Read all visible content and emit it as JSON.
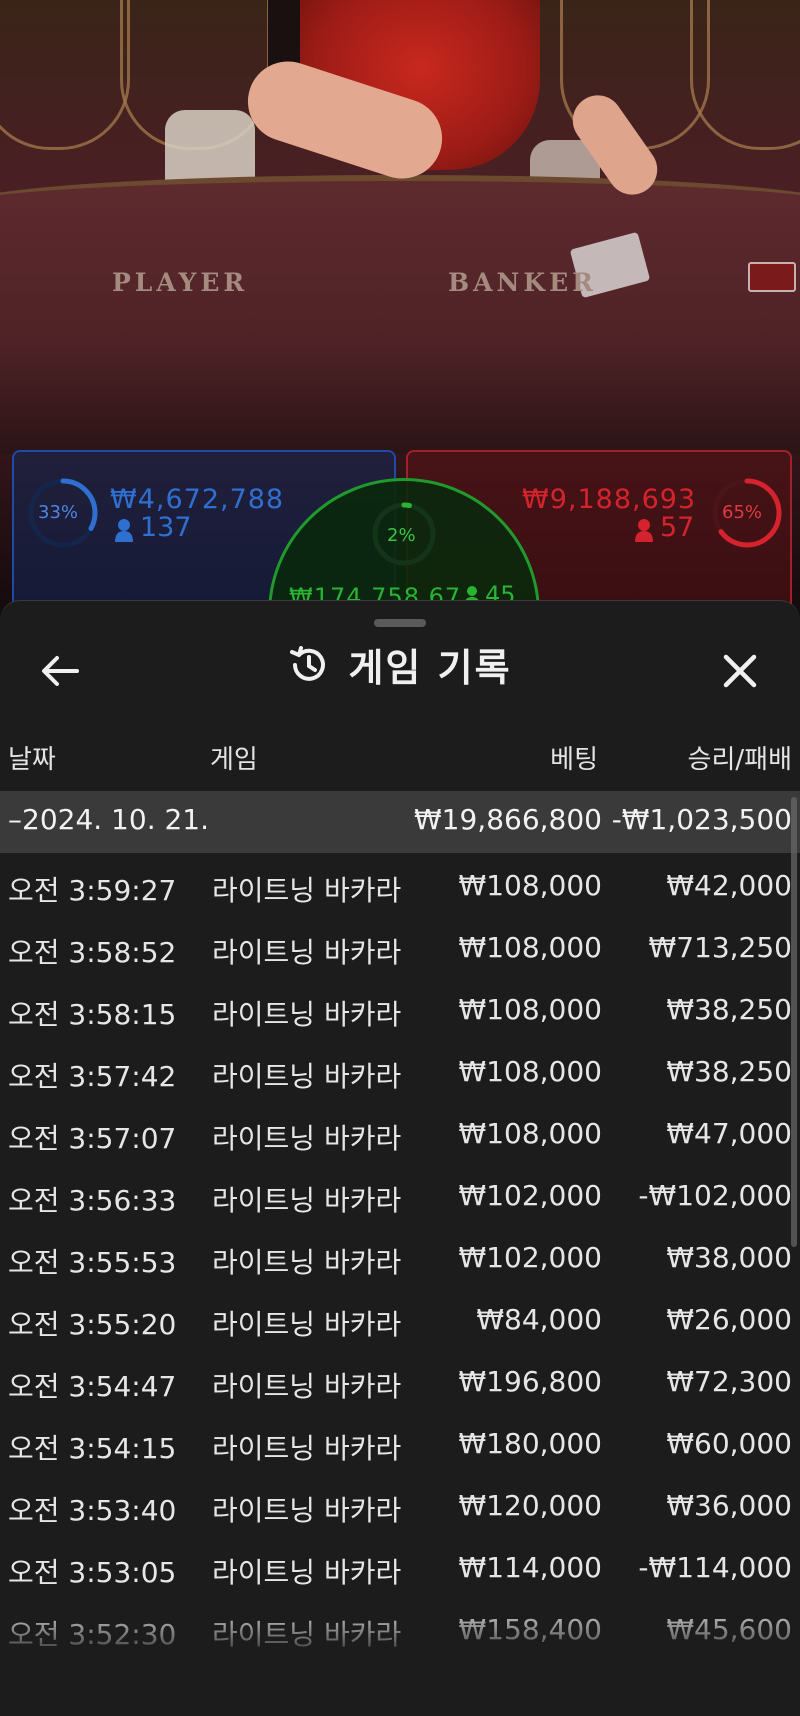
{
  "video": {
    "table_labels": {
      "player": "PLAYER",
      "banker": "BANKER"
    }
  },
  "bets": {
    "player": {
      "percent": "33%",
      "amount": "₩4,672,788",
      "count": "137",
      "color": "#2f6fd0"
    },
    "banker": {
      "percent": "65%",
      "amount": "₩9,188,693",
      "count": "57",
      "color": "#d4232c"
    },
    "tie": {
      "percent": "2%",
      "amount": "₩174,758.67",
      "count": "45",
      "color": "#28b332"
    }
  },
  "sheet": {
    "back_icon": "arrow-left-icon",
    "history_icon": "history-icon",
    "title": "게임 기록",
    "close_icon": "close-icon",
    "columns": {
      "date": "날짜",
      "game": "게임",
      "bet": "베팅",
      "result": "승리/패배"
    },
    "summary": {
      "date": "–2024. 10. 21.",
      "bet": "₩19,866,800",
      "result": "-₩1,023,500"
    },
    "rows": [
      {
        "time": "오전 3:59:27",
        "game": "라이트닝 바카라",
        "bet": "₩108,000",
        "result": "₩42,000"
      },
      {
        "time": "오전 3:58:52",
        "game": "라이트닝 바카라",
        "bet": "₩108,000",
        "result": "₩713,250"
      },
      {
        "time": "오전 3:58:15",
        "game": "라이트닝 바카라",
        "bet": "₩108,000",
        "result": "₩38,250"
      },
      {
        "time": "오전 3:57:42",
        "game": "라이트닝 바카라",
        "bet": "₩108,000",
        "result": "₩38,250"
      },
      {
        "time": "오전 3:57:07",
        "game": "라이트닝 바카라",
        "bet": "₩108,000",
        "result": "₩47,000"
      },
      {
        "time": "오전 3:56:33",
        "game": "라이트닝 바카라",
        "bet": "₩102,000",
        "result": "-₩102,000"
      },
      {
        "time": "오전 3:55:53",
        "game": "라이트닝 바카라",
        "bet": "₩102,000",
        "result": "₩38,000"
      },
      {
        "time": "오전 3:55:20",
        "game": "라이트닝 바카라",
        "bet": "₩84,000",
        "result": "₩26,000"
      },
      {
        "time": "오전 3:54:47",
        "game": "라이트닝 바카라",
        "bet": "₩196,800",
        "result": "₩72,300"
      },
      {
        "time": "오전 3:54:15",
        "game": "라이트닝 바카라",
        "bet": "₩180,000",
        "result": "₩60,000"
      },
      {
        "time": "오전 3:53:40",
        "game": "라이트닝 바카라",
        "bet": "₩120,000",
        "result": "₩36,000"
      },
      {
        "time": "오전 3:53:05",
        "game": "라이트닝 바카라",
        "bet": "₩114,000",
        "result": "-₩114,000"
      },
      {
        "time": "오전 3:52:30",
        "game": "라이트닝 바카라",
        "bet": "₩158,400",
        "result": "₩45,600"
      }
    ]
  }
}
